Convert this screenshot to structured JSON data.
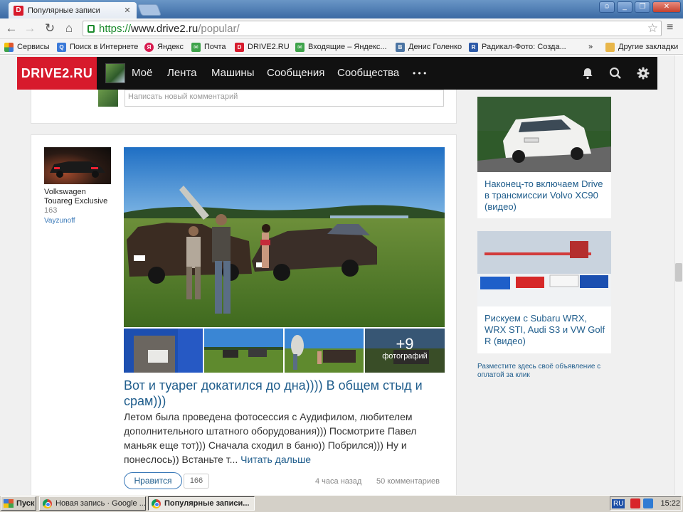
{
  "browser": {
    "tab_title": "Популярные записи",
    "url_scheme": "https://",
    "url_host": "www.drive2.ru",
    "url_path": "/popular/"
  },
  "bookmarks": [
    {
      "label": "Сервисы",
      "icon": "apps-icon",
      "color": "#e0572e"
    },
    {
      "label": "Поиск в Интернете",
      "icon": "search-icon",
      "color": "#3a79d8"
    },
    {
      "label": "Яндекс",
      "icon": "yandex-icon",
      "color": "#d81b4f"
    },
    {
      "label": "Почта",
      "icon": "mail-icon",
      "color": "#3ea34a"
    },
    {
      "label": "DRIVE2.RU",
      "icon": "drive2-icon",
      "color": "#d71a2c"
    },
    {
      "label": "Входящие – Яндекс...",
      "icon": "mail-icon",
      "color": "#3ea34a"
    },
    {
      "label": "Денис Голенко",
      "icon": "vk-icon",
      "color": "#4c75a3"
    },
    {
      "label": "Радикал-Фото: Созда...",
      "icon": "radikal-icon",
      "color": "#2d5aa8"
    },
    {
      "label": "»",
      "icon": "",
      "color": ""
    },
    {
      "label": "Другие закладки",
      "icon": "folder-icon",
      "color": "#e8b64a"
    }
  ],
  "site": {
    "logo": "DRIVE2.RU",
    "nav": [
      "Моё",
      "Лента",
      "Машины",
      "Сообщения",
      "Сообщества",
      "• • •"
    ],
    "accent": "#d71a2c"
  },
  "comment": {
    "placeholder": "Написать новый комментарий"
  },
  "post": {
    "car_name": "Volkswagen Touareg Exclusive",
    "car_count": "163",
    "user": "Vayzunoff",
    "more_photos": "+9",
    "more_photos_label": "фотографий",
    "title": "Вот и туарег докатился до дна)))) В общем стыд и срам)))",
    "body": "Летом была проведена фотосессия с Аудифилом, любителем дополнительного штатного оборудования))) Посмотрите Павел маньяк еще тот))) Сначала сходил в баню)) Побрился))) Ну и понеслось)) Встаньте т...",
    "read_more": "Читать дальше",
    "like_label": "Нравится",
    "likes": "166",
    "time": "4 часа назад",
    "comments": "50 комментариев"
  },
  "ads": [
    {
      "title": "Наконец-то включаем Drive в трансмиссии Volvo XC90 (видео)"
    },
    {
      "title": "Рискуем с Subaru WRX, WRX STI, Audi S3 и VW Golf R (видео)"
    }
  ],
  "ad_note": "Разместите здесь своё объявление с оплатой за клик",
  "taskbar": {
    "start": "Пуск",
    "tasks": [
      "Новая запись · Google ...",
      "Популярные записи..."
    ],
    "lang": "RU",
    "clock": "15:22"
  }
}
